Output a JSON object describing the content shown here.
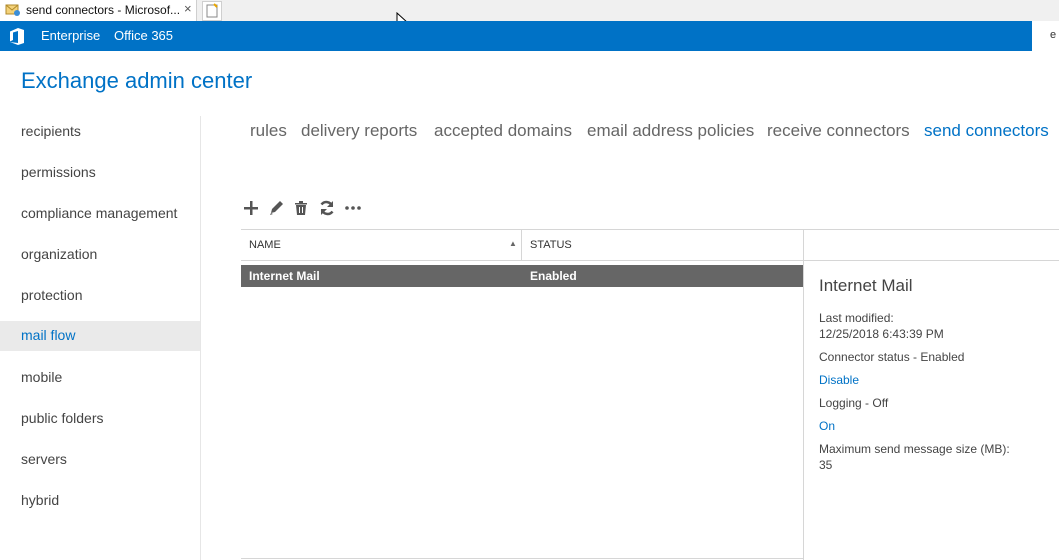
{
  "browser": {
    "tab_title": "send connectors - Microsof...",
    "tab_close": "×"
  },
  "topbar": {
    "nav": [
      "Enterprise",
      "Office 365"
    ],
    "user_fragment": "e"
  },
  "app_title": "Exchange admin center",
  "sidebar": {
    "items": [
      {
        "label": "recipients"
      },
      {
        "label": "permissions"
      },
      {
        "label": "compliance management"
      },
      {
        "label": "organization"
      },
      {
        "label": "protection"
      },
      {
        "label": "mail flow",
        "active": true
      },
      {
        "label": "mobile"
      },
      {
        "label": "public folders"
      },
      {
        "label": "servers"
      },
      {
        "label": "hybrid"
      }
    ]
  },
  "subtabs": [
    {
      "label": "rules"
    },
    {
      "label": "delivery reports"
    },
    {
      "label": "accepted domains"
    },
    {
      "label": "email address policies"
    },
    {
      "label": "receive connectors"
    },
    {
      "label": "send connectors",
      "active": true
    }
  ],
  "toolbar": {
    "icons": [
      "add-icon",
      "edit-icon",
      "delete-icon",
      "refresh-icon",
      "more-icon"
    ]
  },
  "table": {
    "columns": [
      "NAME",
      "STATUS"
    ],
    "rows": [
      {
        "name": "Internet Mail",
        "status": "Enabled",
        "selected": true
      }
    ]
  },
  "details": {
    "title": "Internet Mail",
    "last_modified_label": "Last modified:",
    "last_modified_value": "12/25/2018 6:43:39 PM",
    "connector_status": "Connector status - Enabled",
    "disable_link": "Disable",
    "logging": "Logging - Off",
    "on_link": "On",
    "max_size_label": "Maximum send message size (MB):",
    "max_size_value": "35"
  },
  "colors": {
    "accent": "#0072c6",
    "selected_row": "#666666"
  }
}
